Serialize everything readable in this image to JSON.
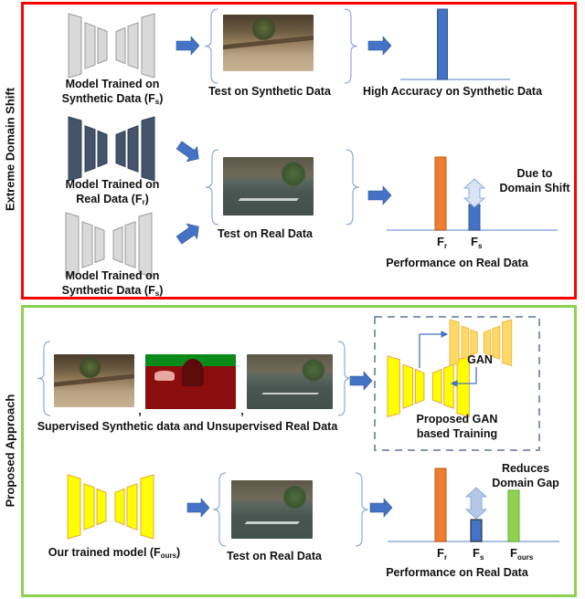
{
  "figure": {
    "sections": [
      {
        "side_label": "Extreme Domain Shift",
        "border_color": "#ff0000",
        "rows": [
          {
            "model": {
              "line1": "Model Trained on",
              "line2_pre": "Synthetic Data (F",
              "sub": "s",
              "line2_post": ")",
              "color": "#d9d9d9"
            },
            "test_label": "Test on Synthetic Data",
            "result_label": "High Accuracy on Synthetic Data"
          },
          {
            "models": [
              {
                "line1": "Model Trained on",
                "line2_pre": "Real Data (F",
                "sub": "r",
                "line2_post": ")",
                "color": "#44546a"
              },
              {
                "line1": "Model Trained on",
                "line2_pre": "Synthetic Data (F",
                "sub": "s",
                "line2_post": ")",
                "color": "#d9d9d9"
              }
            ],
            "test_label": "Test on Real Data",
            "result_label": "Performance on Real Data",
            "annotation_line1": "Due to",
            "annotation_line2": "Domain Shift"
          }
        ]
      },
      {
        "side_label": "Proposed Approach",
        "border_color": "#8cd14f",
        "rows": [
          {
            "data_label": "Supervised Synthetic data and Unsupervised Real Data",
            "separator": ",",
            "gan_label": "GAN",
            "training_line1": "Proposed GAN",
            "training_line2": "based Training"
          },
          {
            "model": {
              "pre": "Our trained model (F",
              "sub": "ours",
              "post": ")",
              "color": "#ffff00"
            },
            "test_label": "Test on Real Data",
            "result_label": "Performance on Real Data",
            "annotation_line1": "Reduces",
            "annotation_line2": "Domain Gap"
          }
        ]
      }
    ]
  },
  "chart_data": [
    {
      "type": "bar",
      "title": "High Accuracy on Synthetic Data",
      "categories": [
        ""
      ],
      "values": [
        1.0
      ],
      "colors": [
        "#4472c4"
      ],
      "ylim": [
        0,
        1.0
      ]
    },
    {
      "type": "bar",
      "title": "Performance on Real Data",
      "categories": [
        {
          "base": "F",
          "sub": "r"
        },
        {
          "base": "F",
          "sub": "s"
        }
      ],
      "values": [
        1.0,
        0.35
      ],
      "colors": [
        "#ed7d31",
        "#4472c4"
      ],
      "ylim": [
        0,
        1.0
      ],
      "annotation": "Due to Domain Shift"
    },
    {
      "type": "bar",
      "title": "Performance on Real Data",
      "categories": [
        {
          "base": "F",
          "sub": "r"
        },
        {
          "base": "F",
          "sub": "s"
        },
        {
          "base": "F",
          "sub": "ours"
        }
      ],
      "values": [
        1.0,
        0.3,
        0.7
      ],
      "colors": [
        "#ed7d31",
        "#4472c4",
        "#92d050"
      ],
      "ylim": [
        0,
        1.0
      ],
      "annotation": "Reduces Domain Gap"
    }
  ],
  "colors": {
    "arrow": "#4472c4",
    "brace": "#8faadc",
    "axis": "#8faadc",
    "dashed_box": "#8497b0",
    "double_arrow_fill": "#dae3f3",
    "gan_yellow": "#ffd966"
  }
}
